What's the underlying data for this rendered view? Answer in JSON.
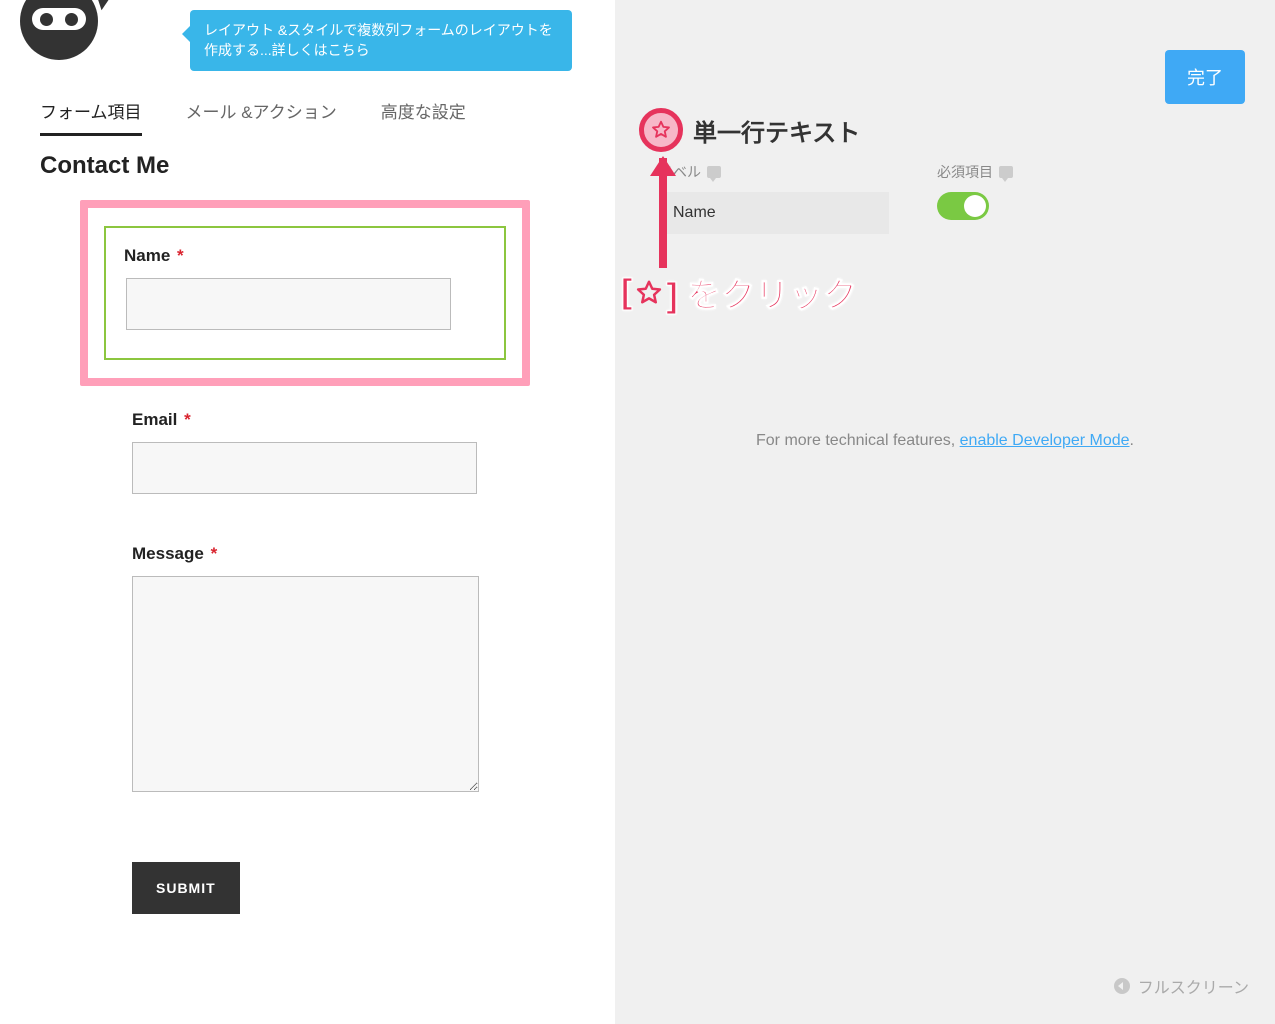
{
  "tooltip": "レイアウト &スタイルで複数列フォームのレイアウトを作成する...詳しくはこちら",
  "tabs": {
    "form_fields": "フォーム項目",
    "mail_actions": "メール &アクション",
    "advanced": "高度な設定"
  },
  "form": {
    "title": "Contact Me",
    "fields": {
      "name": {
        "label": "Name"
      },
      "email": {
        "label": "Email"
      },
      "message": {
        "label": "Message"
      }
    },
    "required_mark": "*",
    "submit_label": "SUBMIT"
  },
  "right": {
    "done_label": "完了",
    "field_type_title": "単一行テキスト",
    "settings": {
      "label_caption": "ラベル",
      "label_value": "Name",
      "required_caption": "必須項目",
      "required_on": true
    },
    "annotation": {
      "prefix": "[",
      "suffix": "] をクリック",
      "star_icon": "star-outline-icon"
    },
    "dev_mode": {
      "prefix": "For more technical features, ",
      "link": "enable Developer Mode",
      "suffix": "."
    },
    "fullscreen_label": "フルスクリーン"
  }
}
